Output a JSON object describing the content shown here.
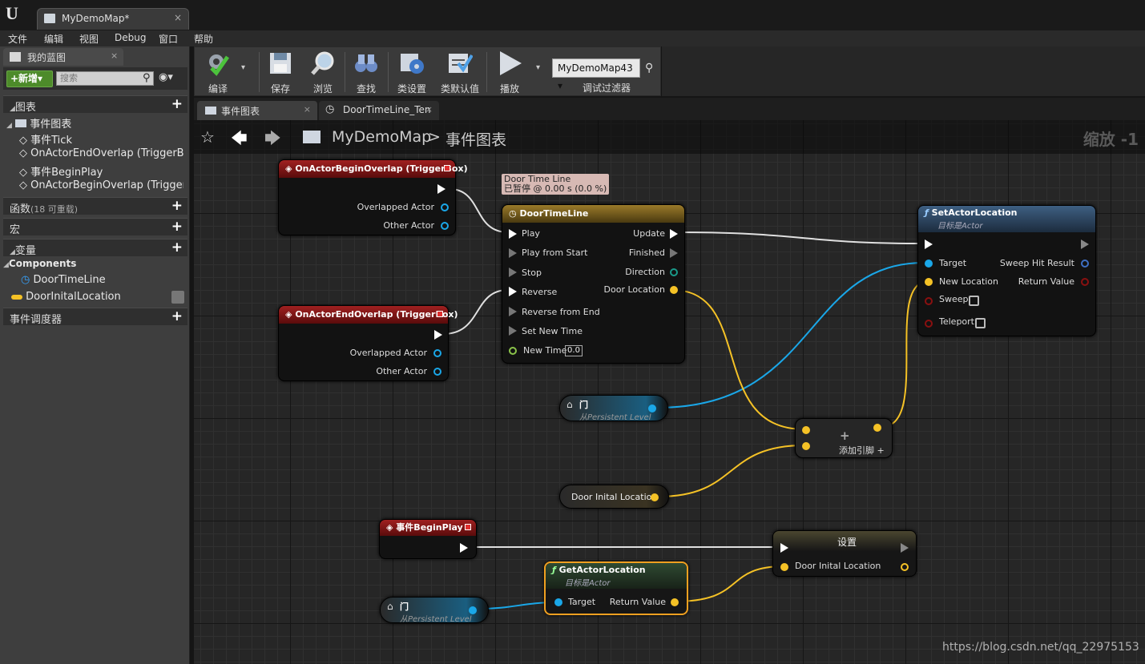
{
  "window": {
    "doc_tab": "MyDemoMap*",
    "close": "×"
  },
  "menu": [
    "文件",
    "编辑",
    "视图",
    "Debug",
    "窗口",
    "帮助"
  ],
  "left_panel": {
    "tab": "我的蓝图",
    "new_button": "+新增▾",
    "search_placeholder": "搜索",
    "sections": {
      "graphs": "图表",
      "event_graph": "事件图表",
      "events": [
        "事件Tick",
        "OnActorEndOverlap (TriggerBox",
        "事件BeginPlay",
        "OnActorBeginOverlap (TriggerBo"
      ],
      "functions": "函数",
      "functions_note": "(18 可重载)",
      "macros": "宏",
      "variables": "变量",
      "components": "Components",
      "component_items": [
        "DoorTimeLine"
      ],
      "variable_items": [
        "DoorInitalLocation"
      ],
      "dispatchers": "事件调度器"
    }
  },
  "toolbar": {
    "buttons": [
      "编译",
      "保存",
      "浏览",
      "查找",
      "类设置",
      "类默认值",
      "播放"
    ],
    "debug_select": "MyDemoMap43",
    "debug_label": "调试过滤器"
  },
  "graph_tabs": [
    "事件图表",
    "DoorTimeLine_Ten"
  ],
  "breadcrumb": {
    "map": "MyDemoMap",
    "sep": ">",
    "graph": "事件图表"
  },
  "zoom": "缩放 -1",
  "nodes": {
    "begin_overlap": {
      "title": "OnActorBeginOverlap (TriggerBox)",
      "pins": [
        "Overlapped Actor",
        "Other Actor"
      ]
    },
    "end_overlap": {
      "title": "OnActorEndOverlap (TriggerBox)",
      "pins": [
        "Overlapped Actor",
        "Other Actor"
      ]
    },
    "timeline": {
      "tooltip_line1": "Door Time Line",
      "tooltip_line2": "已暂停 @ 0.00 s (0.0 %)",
      "title": "DoorTimeLine",
      "inputs": [
        "Play",
        "Play from Start",
        "Stop",
        "Reverse",
        "Reverse from End",
        "Set New Time",
        "New Time"
      ],
      "new_time_value": "0.0",
      "outputs": [
        "Update",
        "Finished",
        "Direction",
        "Door Location"
      ]
    },
    "set_actor_location": {
      "title": "SetActorLocation",
      "subtitle": "目标是Actor",
      "inputs": [
        "Target",
        "New Location",
        "Sweep",
        "Teleport"
      ],
      "outputs": [
        "Sweep Hit Result",
        "Return Value"
      ]
    },
    "door_ref_1": {
      "title": "门",
      "subtitle": "从Persistent Level"
    },
    "add_node": {
      "plus": "+",
      "label": "添加引脚 +"
    },
    "door_inital_get": {
      "label": "Door Inital Location"
    },
    "begin_play": {
      "title": "事件BeginPlay"
    },
    "set_node": {
      "title": "设置",
      "pin": "Door Inital Location"
    },
    "get_actor_location": {
      "title": "GetActorLocation",
      "subtitle": "目标是Actor",
      "input": "Target",
      "output": "Return Value"
    },
    "door_ref_2": {
      "title": "门",
      "subtitle": "从Persistent Level"
    }
  },
  "watermark": "https://blog.csdn.net/qq_22975153",
  "colors": {
    "exec": "#ffffff",
    "object": "#1aa7e8",
    "vector": "#f5c226",
    "event_header": "#8a1414",
    "func_header": "#3d5a78",
    "float": "#8bc34a",
    "struct": "#3e6fc4"
  }
}
